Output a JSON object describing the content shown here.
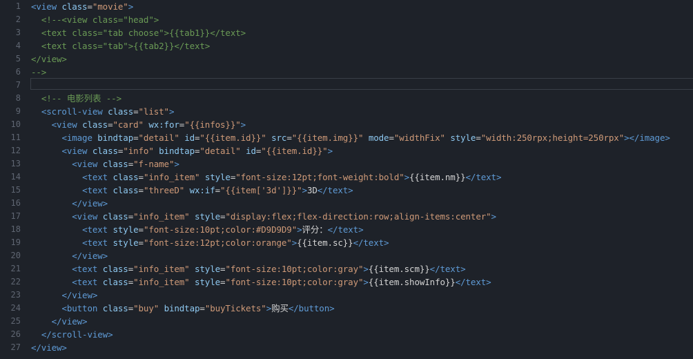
{
  "editor": {
    "lines": [
      {
        "n": "1",
        "indent": 0,
        "tokens": [
          [
            "tag",
            "<view"
          ],
          [
            "txt",
            " "
          ],
          [
            "attr",
            "class"
          ],
          [
            "txt",
            "="
          ],
          [
            "str",
            "\"movie\""
          ],
          [
            "tag",
            ">"
          ]
        ]
      },
      {
        "n": "2",
        "indent": 1,
        "tokens": [
          [
            "cm",
            "<!--<view class=\"head\">"
          ]
        ]
      },
      {
        "n": "3",
        "indent": 1,
        "tokens": [
          [
            "cm",
            "<text class=\"tab choose\">{{tab1}}</text>"
          ]
        ]
      },
      {
        "n": "4",
        "indent": 1,
        "tokens": [
          [
            "cm",
            "<text class=\"tab\">{{tab2}}</text>"
          ]
        ]
      },
      {
        "n": "5",
        "indent": 0,
        "tokens": [
          [
            "cm",
            "</view>"
          ]
        ]
      },
      {
        "n": "6",
        "indent": 0,
        "tokens": [
          [
            "cm",
            "-->"
          ]
        ]
      },
      {
        "n": "7",
        "indent": 0,
        "tokens": []
      },
      {
        "n": "8",
        "indent": 1,
        "tokens": [
          [
            "cm",
            "<!-- 电影列表 -->"
          ]
        ]
      },
      {
        "n": "9",
        "indent": 1,
        "tokens": [
          [
            "tag",
            "<scroll-view"
          ],
          [
            "txt",
            " "
          ],
          [
            "attr",
            "class"
          ],
          [
            "txt",
            "="
          ],
          [
            "str",
            "\"list\""
          ],
          [
            "tag",
            ">"
          ]
        ]
      },
      {
        "n": "10",
        "indent": 2,
        "tokens": [
          [
            "tag",
            "<view"
          ],
          [
            "txt",
            " "
          ],
          [
            "attr",
            "class"
          ],
          [
            "txt",
            "="
          ],
          [
            "str",
            "\"card\""
          ],
          [
            "txt",
            " "
          ],
          [
            "attr",
            "wx:for"
          ],
          [
            "txt",
            "="
          ],
          [
            "str",
            "\"{{infos}}\""
          ],
          [
            "tag",
            ">"
          ]
        ]
      },
      {
        "n": "11",
        "indent": 3,
        "tokens": [
          [
            "tag",
            "<image"
          ],
          [
            "txt",
            " "
          ],
          [
            "attr",
            "bindtap"
          ],
          [
            "txt",
            "="
          ],
          [
            "str",
            "\"detail\""
          ],
          [
            "txt",
            " "
          ],
          [
            "attr",
            "id"
          ],
          [
            "txt",
            "="
          ],
          [
            "str",
            "\"{{item.id}}\""
          ],
          [
            "txt",
            " "
          ],
          [
            "attr",
            "src"
          ],
          [
            "txt",
            "="
          ],
          [
            "str",
            "\"{{item.img}}\""
          ],
          [
            "txt",
            " "
          ],
          [
            "attr",
            "mode"
          ],
          [
            "txt",
            "="
          ],
          [
            "str",
            "\"widthFix\""
          ],
          [
            "txt",
            " "
          ],
          [
            "attr",
            "style"
          ],
          [
            "txt",
            "="
          ],
          [
            "str",
            "\"width:250rpx;height=250rpx\""
          ],
          [
            "tag",
            "></image>"
          ]
        ]
      },
      {
        "n": "12",
        "indent": 3,
        "tokens": [
          [
            "tag",
            "<view"
          ],
          [
            "txt",
            " "
          ],
          [
            "attr",
            "class"
          ],
          [
            "txt",
            "="
          ],
          [
            "str",
            "\"info\""
          ],
          [
            "txt",
            " "
          ],
          [
            "attr",
            "bindtap"
          ],
          [
            "txt",
            "="
          ],
          [
            "str",
            "\"detail\""
          ],
          [
            "txt",
            " "
          ],
          [
            "attr",
            "id"
          ],
          [
            "txt",
            "="
          ],
          [
            "str",
            "\"{{item.id}}\""
          ],
          [
            "tag",
            ">"
          ]
        ]
      },
      {
        "n": "13",
        "indent": 4,
        "tokens": [
          [
            "tag",
            "<view"
          ],
          [
            "txt",
            " "
          ],
          [
            "attr",
            "class"
          ],
          [
            "txt",
            "="
          ],
          [
            "str",
            "\"f-name\""
          ],
          [
            "tag",
            ">"
          ]
        ]
      },
      {
        "n": "14",
        "indent": 5,
        "tokens": [
          [
            "tag",
            "<text"
          ],
          [
            "txt",
            " "
          ],
          [
            "attr",
            "class"
          ],
          [
            "txt",
            "="
          ],
          [
            "str",
            "\"info_item\""
          ],
          [
            "txt",
            " "
          ],
          [
            "attr",
            "style"
          ],
          [
            "txt",
            "="
          ],
          [
            "str",
            "\"font-size:12pt;font-weight:bold\""
          ],
          [
            "tag",
            ">"
          ],
          [
            "txt",
            "{{item.nm}}"
          ],
          [
            "tag",
            "</text>"
          ]
        ]
      },
      {
        "n": "15",
        "indent": 5,
        "tokens": [
          [
            "tag",
            "<text"
          ],
          [
            "txt",
            " "
          ],
          [
            "attr",
            "class"
          ],
          [
            "txt",
            "="
          ],
          [
            "str",
            "\"threeD\""
          ],
          [
            "txt",
            " "
          ],
          [
            "attr",
            "wx:if"
          ],
          [
            "txt",
            "="
          ],
          [
            "str",
            "\"{{item['3d']}}\""
          ],
          [
            "tag",
            ">"
          ],
          [
            "txt",
            "3D"
          ],
          [
            "tag",
            "</text>"
          ]
        ]
      },
      {
        "n": "16",
        "indent": 4,
        "tokens": [
          [
            "tag",
            "</view>"
          ]
        ]
      },
      {
        "n": "17",
        "indent": 4,
        "tokens": [
          [
            "tag",
            "<view"
          ],
          [
            "txt",
            " "
          ],
          [
            "attr",
            "class"
          ],
          [
            "txt",
            "="
          ],
          [
            "str",
            "\"info_item\""
          ],
          [
            "txt",
            " "
          ],
          [
            "attr",
            "style"
          ],
          [
            "txt",
            "="
          ],
          [
            "str",
            "\"display:flex;flex-direction:row;align-items:center\""
          ],
          [
            "tag",
            ">"
          ]
        ]
      },
      {
        "n": "18",
        "indent": 5,
        "tokens": [
          [
            "tag",
            "<text"
          ],
          [
            "txt",
            " "
          ],
          [
            "attr",
            "style"
          ],
          [
            "txt",
            "="
          ],
          [
            "str",
            "\"font-size:10pt;color:#D9D9D9\""
          ],
          [
            "tag",
            ">"
          ],
          [
            "txt",
            "评分："
          ],
          [
            "tag",
            "</text>"
          ]
        ]
      },
      {
        "n": "19",
        "indent": 5,
        "tokens": [
          [
            "tag",
            "<text"
          ],
          [
            "txt",
            " "
          ],
          [
            "attr",
            "style"
          ],
          [
            "txt",
            "="
          ],
          [
            "str",
            "\"font-size:12pt;color:orange\""
          ],
          [
            "tag",
            ">"
          ],
          [
            "txt",
            "{{item.sc}}"
          ],
          [
            "tag",
            "</text>"
          ]
        ]
      },
      {
        "n": "20",
        "indent": 4,
        "tokens": [
          [
            "tag",
            "</view>"
          ]
        ]
      },
      {
        "n": "21",
        "indent": 4,
        "tokens": [
          [
            "tag",
            "<text"
          ],
          [
            "txt",
            " "
          ],
          [
            "attr",
            "class"
          ],
          [
            "txt",
            "="
          ],
          [
            "str",
            "\"info_item\""
          ],
          [
            "txt",
            " "
          ],
          [
            "attr",
            "style"
          ],
          [
            "txt",
            "="
          ],
          [
            "str",
            "\"font-size:10pt;color:gray\""
          ],
          [
            "tag",
            ">"
          ],
          [
            "txt",
            "{{item.scm}}"
          ],
          [
            "tag",
            "</text>"
          ]
        ]
      },
      {
        "n": "22",
        "indent": 4,
        "tokens": [
          [
            "tag",
            "<text"
          ],
          [
            "txt",
            " "
          ],
          [
            "attr",
            "class"
          ],
          [
            "txt",
            "="
          ],
          [
            "str",
            "\"info_item\""
          ],
          [
            "txt",
            " "
          ],
          [
            "attr",
            "style"
          ],
          [
            "txt",
            "="
          ],
          [
            "str",
            "\"font-size:10pt;color:gray\""
          ],
          [
            "tag",
            ">"
          ],
          [
            "txt",
            "{{item.showInfo}}"
          ],
          [
            "tag",
            "</text>"
          ]
        ]
      },
      {
        "n": "23",
        "indent": 3,
        "tokens": [
          [
            "tag",
            "</view>"
          ]
        ]
      },
      {
        "n": "24",
        "indent": 3,
        "tokens": [
          [
            "tag",
            "<button"
          ],
          [
            "txt",
            " "
          ],
          [
            "attr",
            "class"
          ],
          [
            "txt",
            "="
          ],
          [
            "str",
            "\"buy\""
          ],
          [
            "txt",
            " "
          ],
          [
            "attr",
            "bindtap"
          ],
          [
            "txt",
            "="
          ],
          [
            "str",
            "\"buyTickets\""
          ],
          [
            "tag",
            ">"
          ],
          [
            "txt",
            "购买"
          ],
          [
            "tag",
            "</button>"
          ]
        ]
      },
      {
        "n": "25",
        "indent": 2,
        "tokens": [
          [
            "tag",
            "</view>"
          ]
        ]
      },
      {
        "n": "26",
        "indent": 1,
        "tokens": [
          [
            "tag",
            "</scroll-view>"
          ]
        ]
      },
      {
        "n": "27",
        "indent": 0,
        "tokens": [
          [
            "tag",
            "</view>"
          ]
        ]
      }
    ]
  },
  "colors": {
    "background": "#1e2229",
    "tag": "#5f9bd6",
    "attribute": "#8ec8f0",
    "string": "#cf9a78",
    "comment": "#6a9a55",
    "text": "#d4d4d4",
    "line_number": "#5f6672"
  }
}
